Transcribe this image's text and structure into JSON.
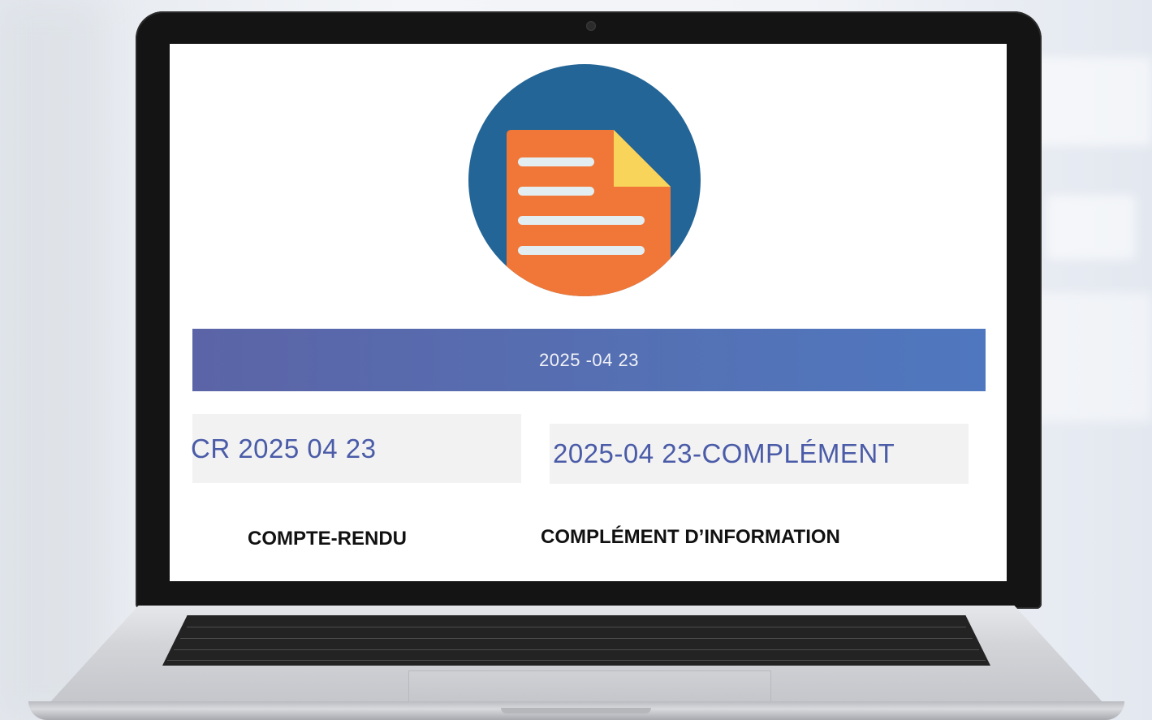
{
  "screen": {
    "date_banner": "2025 -04 23",
    "files": [
      {
        "name": "CR 2025 04 23",
        "caption": "COMPTE-RENDU"
      },
      {
        "name": "2025-04 23-COMPLÉMENT",
        "caption": "COMPLÉMENT D’INFORMATION"
      }
    ],
    "icon": "document-icon"
  },
  "colors": {
    "icon_circle": "#236596",
    "doc_orange": "#f07737",
    "doc_fold": "#f9d45a",
    "doc_lines": "#e3eef2",
    "banner": "#5570b3",
    "file_text": "#4a5ba8"
  }
}
